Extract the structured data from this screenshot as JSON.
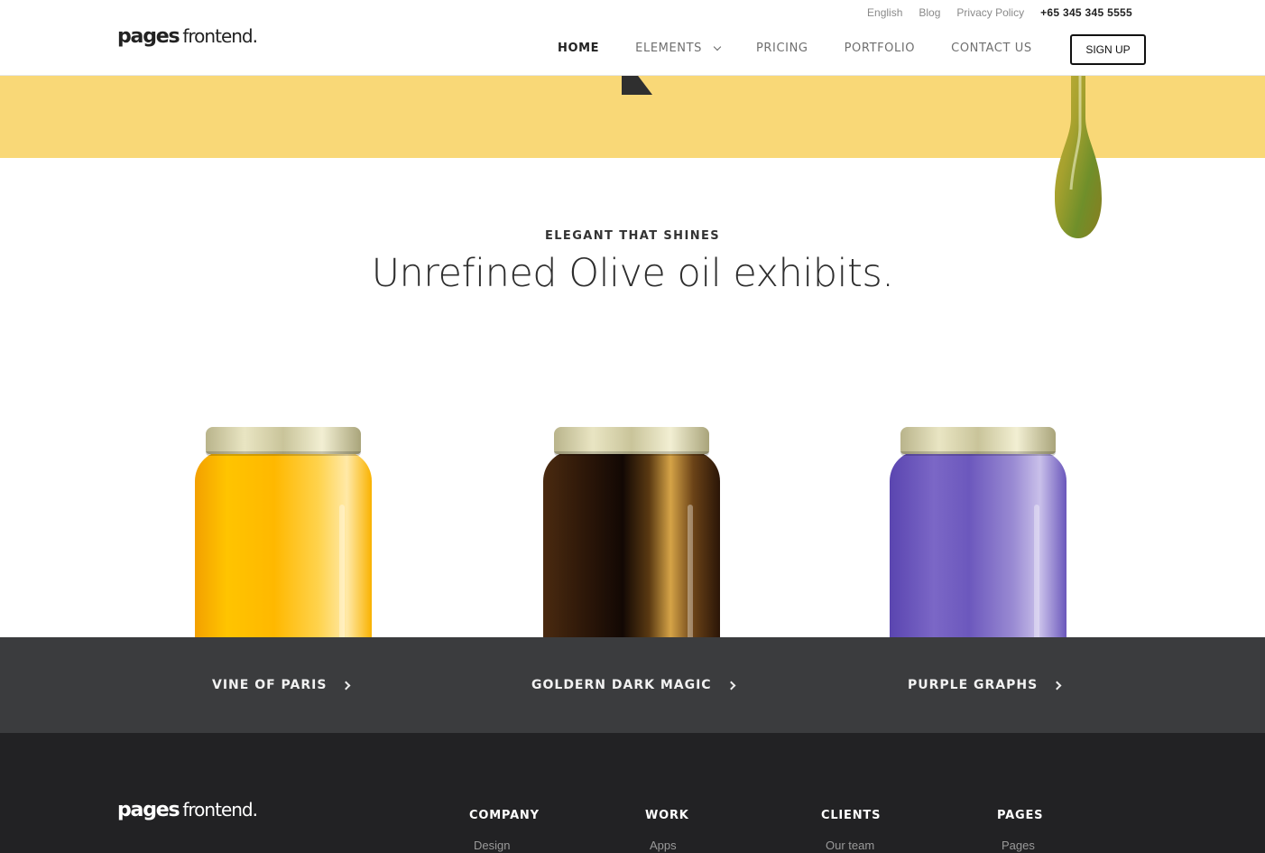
{
  "brand": {
    "logo_bold": "pages",
    "logo_light": "frontend."
  },
  "topbar": {
    "language": "English",
    "blog": "Blog",
    "privacy": "Privacy Policy",
    "phone": "+65 345 345 5555"
  },
  "nav": {
    "items": [
      {
        "label": "HOME",
        "active": true
      },
      {
        "label": "ELEMENTS",
        "active": false,
        "has_dropdown": true
      },
      {
        "label": "PRICING",
        "active": false
      },
      {
        "label": "PORTFOLIO",
        "active": false
      },
      {
        "label": "CONTACT US",
        "active": false
      }
    ],
    "signup_label": "SIGN UP"
  },
  "hero": {
    "band_color": "#f9d877",
    "eyebrow": "ELEGANT THAT SHINES",
    "headline": "Unrefined Olive oil exhibits."
  },
  "products": [
    {
      "label": "VINE OF PARIS",
      "color": "#ffb800"
    },
    {
      "label": "GOLDERN DARK MAGIC",
      "color": "#2b1608"
    },
    {
      "label": "PURPLE GRAPHS",
      "color": "#7b67c6"
    }
  ],
  "footer": {
    "columns": [
      {
        "heading": "COMPANY",
        "first_link": "Design"
      },
      {
        "heading": "WORK",
        "first_link": "Apps"
      },
      {
        "heading": "CLIENTS",
        "first_link": "Our team"
      },
      {
        "heading": "PAGES",
        "first_link": "Pages"
      }
    ]
  }
}
